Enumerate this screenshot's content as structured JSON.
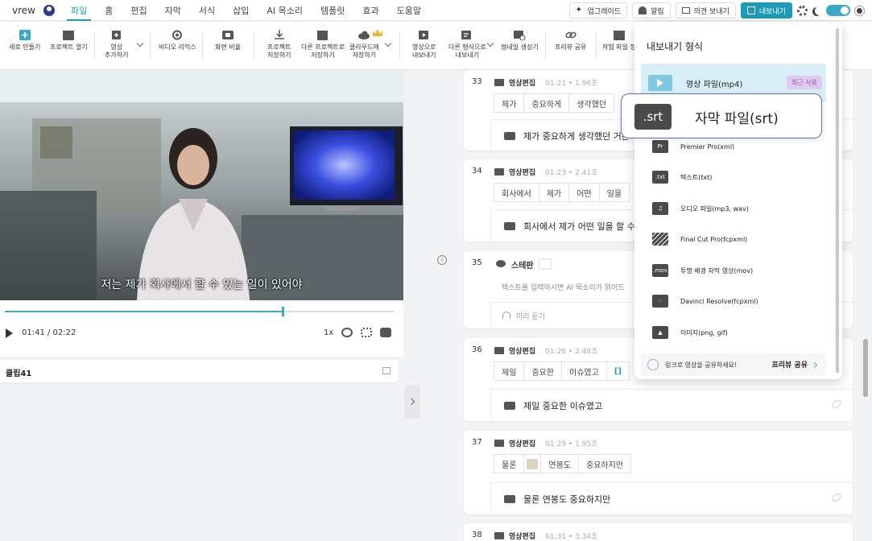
{
  "app": {
    "name": "vrew"
  },
  "menu": [
    "파일",
    "홈",
    "편집",
    "자막",
    "서식",
    "삽입",
    "AI 목소리",
    "템플릿",
    "효과",
    "도움말"
  ],
  "topbar": {
    "upgrade": "업그레이드",
    "notifications": "알림",
    "feedback": "의견 보내기",
    "export": "내보내기"
  },
  "toolbar": {
    "new": "새로 만들기",
    "open": "프로젝트 열기",
    "add_video": [
      "영상",
      "추가하기"
    ],
    "video_remix": "비디오 리믹스",
    "aspect": "화면 비율",
    "save_project": [
      "프로젝트",
      "저장하기"
    ],
    "save_other": [
      "다른 프로젝트로",
      "저장하기"
    ],
    "save_cloud": [
      "클라우드에",
      "저장하기"
    ],
    "export_video": [
      "영상으로",
      "내보내기"
    ],
    "export_other": [
      "다른 형식으로",
      "내보내기"
    ],
    "thumbnail": "썸네일 생성기",
    "preview_share": "프리뷰 공유",
    "save_work": "작업 파일 정"
  },
  "player": {
    "subtitle": "저는 제가 회사에서 할 수 있는 일이 있어야",
    "progress": 0.71,
    "time_current": "01:41",
    "time_total": "/ 02:22",
    "speed": "1x"
  },
  "clip_panel": {
    "label": "클립41"
  },
  "colors": {
    "accent": "#1d9bb5",
    "highlight": "#5b6fd6",
    "recent_badge": "#e1c9f0"
  },
  "clips": [
    {
      "num": "33",
      "type": "영상편집",
      "meta": "01:21 • 1.96초",
      "words": [
        "제가",
        "중요하게",
        "생각했던"
      ],
      "subtitle": "제가 중요하게 생각했던 거는"
    },
    {
      "num": "34",
      "type": "영상편집",
      "meta": "01:23 • 2.41초",
      "words": [
        "회사에서",
        "제가",
        "어떤",
        "일을"
      ],
      "subtitle": "회사에서 제가 어떤 일을 할 수 있는"
    },
    {
      "num": "35",
      "type": "tts",
      "speaker": "스테판",
      "placeholder": "텍스트를 입력하시면 AI 목소리가 읽어드",
      "preview": "미리 듣기"
    },
    {
      "num": "36",
      "type": "영상편집",
      "meta": "01:26 • 2.48초",
      "words": [
        "제일",
        "중요한",
        "이슈였고",
        "[]"
      ],
      "subtitle": "제일 중요한 이슈였고"
    },
    {
      "num": "37",
      "type": "영상편집",
      "meta": "01:29 • 1.95초",
      "words": [
        "물론",
        "",
        "연봉도",
        "중요하지만"
      ],
      "subtitle": "물론 연봉도 중요하지만"
    },
    {
      "num": "38",
      "type": "영상편집",
      "meta": "01:31 • 3.34초"
    }
  ],
  "export_menu": {
    "title": "내보내기 형식",
    "recent": {
      "label": "영상 파일(mp4)",
      "badge": "최근 사용"
    },
    "highlight": {
      "icon": ".srt",
      "label": "자막 파일(srt)"
    },
    "options": [
      {
        "icon": "Pr",
        "label": "Premier Pro(xml)"
      },
      {
        "icon": ".txt",
        "label": "텍스트(txt)"
      },
      {
        "icon": "music-note-icon",
        "label": "오디오 파일(mp3, wav)"
      },
      {
        "icon": "clapper-icon",
        "label": "Final Cut Pro(fcpxml)"
      },
      {
        "icon": ".mov",
        "label": "투명 배경 자막 영상(mov)"
      },
      {
        "icon": "davinci-icon",
        "label": "Davinci Resolve(fcpxml)"
      },
      {
        "icon": "image-icon",
        "label": "이미지(png, gif)"
      }
    ],
    "share_text": "링크로 영상을 공유하세요!",
    "share_button": "프리뷰 공유"
  }
}
